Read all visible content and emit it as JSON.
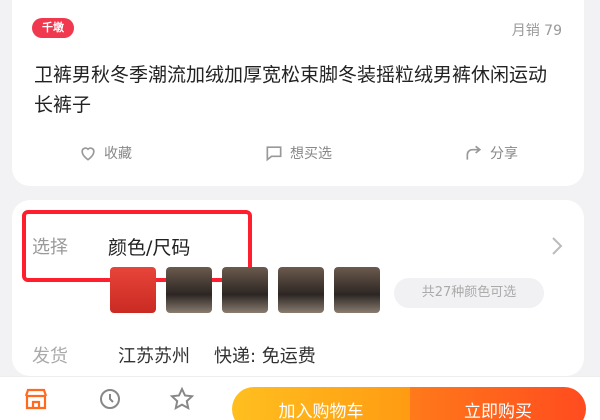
{
  "product": {
    "promo_tag": "千墩",
    "sold": "月销 79",
    "title": "卫裤男秋冬季潮流加绒加厚宽松束脚冬装摇粒绒男裤休闲运动长裤子"
  },
  "actions": [
    {
      "label": "收藏",
      "icon": "heart-icon"
    },
    {
      "label": "想买选",
      "icon": "chat-icon"
    },
    {
      "label": "分享",
      "icon": "share-icon"
    }
  ],
  "spec": {
    "select_label": "选择",
    "select_value": "颜色/尺码",
    "swatch_count": "共27种颜色可选"
  },
  "shipping": {
    "label": "发货",
    "origin": "江苏苏州",
    "method": "快递: 免运费"
  },
  "bottom_bar": {
    "add_to_cart": "加入购物车",
    "buy_now": "立即购买"
  },
  "colors": {
    "accent": "#ff4b1f",
    "highlight": "#ff1e2e",
    "cart": "#ffad18"
  }
}
